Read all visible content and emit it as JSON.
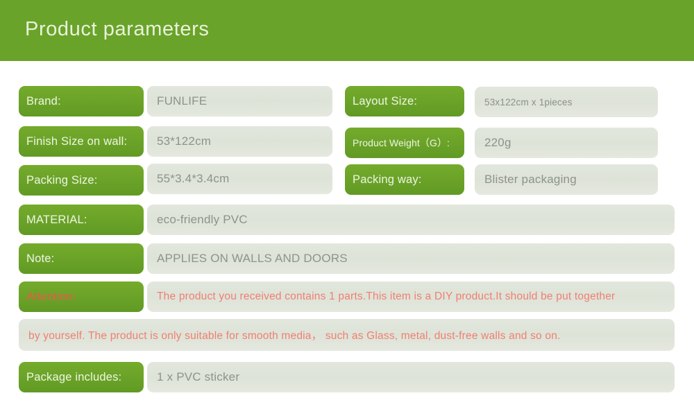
{
  "header": {
    "title": "Product parameters",
    "bg_color": "#6aa329",
    "title_color": "#e9f2dd"
  },
  "colors": {
    "label_green": "#6aa228",
    "value_gray": "#e0e5db",
    "value_text": "#8d938c",
    "alert_red": "#ef7f72",
    "label_alert_red": "#e2593f"
  },
  "rows": {
    "brand": {
      "label": "Brand:",
      "value": "FUNLIFE"
    },
    "layout_size": {
      "label": "Layout Size:",
      "value": "53x122cm x 1pieces"
    },
    "finish_size": {
      "label": "Finish Size on wall:",
      "value": "53*122cm"
    },
    "product_weight": {
      "label": "Product Weight（G）:",
      "value": "220g"
    },
    "packing_size": {
      "label": "Packing Size:",
      "value": "55*3.4*3.4cm"
    },
    "packing_way": {
      "label": "Packing way:",
      "value": "Blister packaging"
    },
    "material": {
      "label": "MATERIAL:",
      "value": "eco-friendly PVC"
    },
    "note": {
      "label": "Note:",
      "value": "APPLIES ON WALLS AND DOORS"
    },
    "attention": {
      "label": "Attention:",
      "value_line1": "The product you received contains 1 parts.This item is a DIY product.It should be put together",
      "value_line2": "by yourself. The product is only suitable for smooth media， such as Glass, metal, dust-free walls and so on."
    },
    "package_includes": {
      "label": "Package includes:",
      "value": "1 x PVC sticker"
    }
  }
}
